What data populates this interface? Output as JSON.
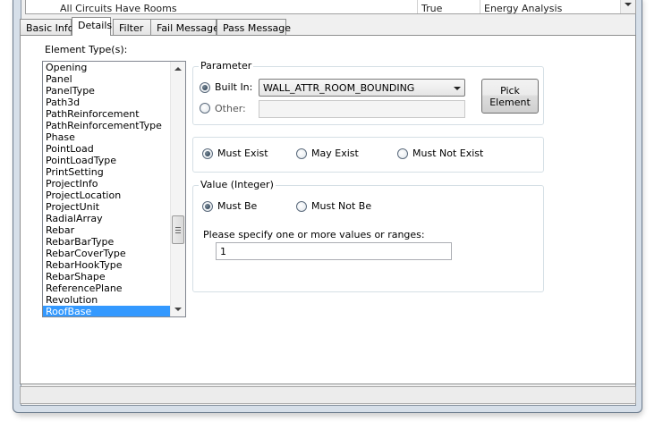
{
  "top_list": {
    "row": {
      "name": "All Circuits Have Rooms",
      "value": "True",
      "category": "Energy Analysis"
    }
  },
  "tabs": [
    {
      "label": "Basic Info",
      "active": false
    },
    {
      "label": "Details",
      "active": true
    },
    {
      "label": "Filter",
      "active": false
    },
    {
      "label": "Fail Message",
      "active": false
    },
    {
      "label": "Pass Message",
      "active": false
    }
  ],
  "details": {
    "element_types_label": "Element Type(s):",
    "element_types": [
      "Opening",
      "Panel",
      "PanelType",
      "Path3d",
      "PathReinforcement",
      "PathReinforcementType",
      "Phase",
      "PointLoad",
      "PointLoadType",
      "PrintSetting",
      "ProjectInfo",
      "ProjectLocation",
      "ProjectUnit",
      "RadialArray",
      "Rebar",
      "RebarBarType",
      "RebarCoverType",
      "RebarHookType",
      "RebarShape",
      "ReferencePlane",
      "Revolution",
      "RoofBase"
    ],
    "selected_element_type": "RoofBase",
    "parameter": {
      "title": "Parameter",
      "builtin_label": "Built In:",
      "builtin_selected": true,
      "builtin_value": "WALL_ATTR_ROOM_BOUNDING",
      "other_label": "Other:",
      "other_value": "",
      "pick_button_line1": "Pick",
      "pick_button_line2": "Element"
    },
    "existence": {
      "must_exist": "Must Exist",
      "may_exist": "May Exist",
      "must_not_exist": "Must Not Exist",
      "selected": "must_exist"
    },
    "value": {
      "title": "Value (Integer)",
      "must_be": "Must Be",
      "must_not_be": "Must Not Be",
      "selected": "must_be",
      "prompt": "Please specify one or more values or ranges:",
      "input_value": "1"
    }
  },
  "status": {
    "text": ""
  }
}
